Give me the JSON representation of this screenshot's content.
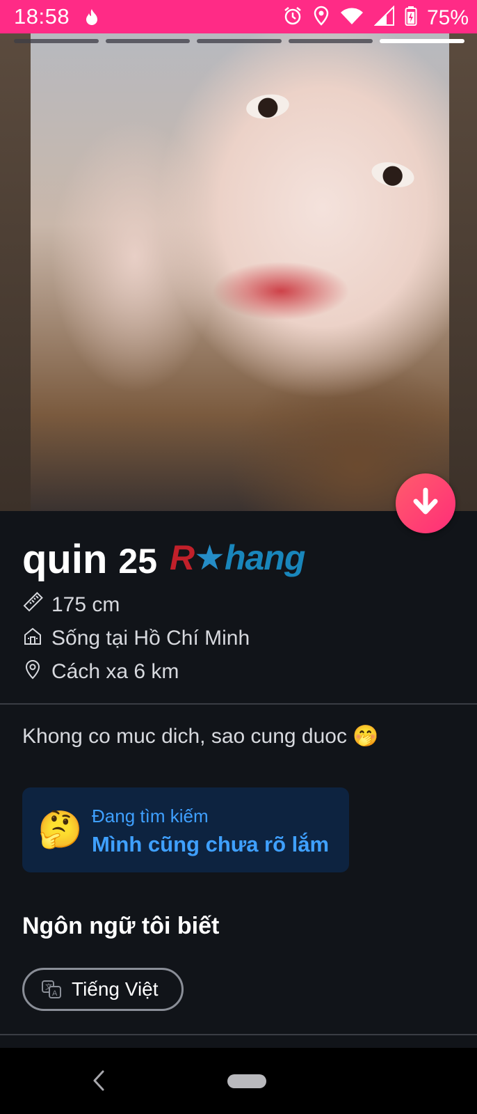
{
  "status_bar": {
    "time": "18:58",
    "battery_percent": "75%",
    "background_color": "#ff2b86",
    "icons": [
      "tinder-flame-icon",
      "alarm-icon",
      "location-icon",
      "wifi-icon",
      "signal-icon",
      "battery-icon"
    ]
  },
  "photo": {
    "segments_total": 5,
    "active_segment": 5
  },
  "profile": {
    "name": "quin",
    "age": "25",
    "height": "175 cm",
    "lives_in": "Sống tại Hồ Chí Minh",
    "distance": "Cách xa 6 km",
    "bio": "Khong co muc dich, sao cung duoc 🤭"
  },
  "watermark": {
    "r": "R",
    "rest": "hang"
  },
  "looking_for": {
    "emoji": "🤔",
    "label": "Đang tìm kiếm",
    "value": "Mình cũng chưa rõ lắm"
  },
  "languages": {
    "title": "Ngôn ngữ tôi biết",
    "items": [
      "Tiếng Việt"
    ]
  },
  "colors": {
    "accent_pink": "#ff2d78",
    "looking_blue": "#3fa0ff",
    "background": "#111419"
  }
}
